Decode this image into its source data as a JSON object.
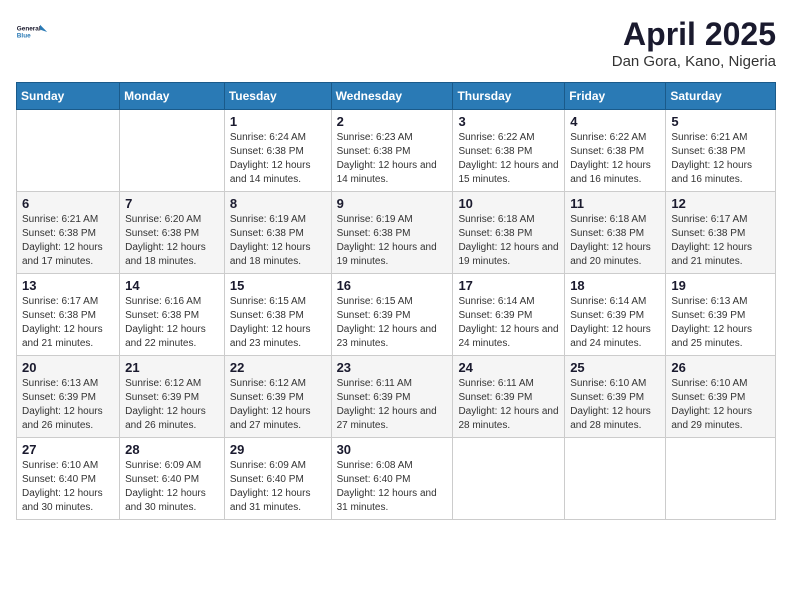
{
  "header": {
    "logo_line1": "General",
    "logo_line2": "Blue",
    "month": "April 2025",
    "location": "Dan Gora, Kano, Nigeria"
  },
  "weekdays": [
    "Sunday",
    "Monday",
    "Tuesday",
    "Wednesday",
    "Thursday",
    "Friday",
    "Saturday"
  ],
  "weeks": [
    [
      {
        "num": "",
        "info": ""
      },
      {
        "num": "",
        "info": ""
      },
      {
        "num": "1",
        "info": "Sunrise: 6:24 AM\nSunset: 6:38 PM\nDaylight: 12 hours\nand 14 minutes."
      },
      {
        "num": "2",
        "info": "Sunrise: 6:23 AM\nSunset: 6:38 PM\nDaylight: 12 hours\nand 14 minutes."
      },
      {
        "num": "3",
        "info": "Sunrise: 6:22 AM\nSunset: 6:38 PM\nDaylight: 12 hours\nand 15 minutes."
      },
      {
        "num": "4",
        "info": "Sunrise: 6:22 AM\nSunset: 6:38 PM\nDaylight: 12 hours\nand 16 minutes."
      },
      {
        "num": "5",
        "info": "Sunrise: 6:21 AM\nSunset: 6:38 PM\nDaylight: 12 hours\nand 16 minutes."
      }
    ],
    [
      {
        "num": "6",
        "info": "Sunrise: 6:21 AM\nSunset: 6:38 PM\nDaylight: 12 hours\nand 17 minutes."
      },
      {
        "num": "7",
        "info": "Sunrise: 6:20 AM\nSunset: 6:38 PM\nDaylight: 12 hours\nand 18 minutes."
      },
      {
        "num": "8",
        "info": "Sunrise: 6:19 AM\nSunset: 6:38 PM\nDaylight: 12 hours\nand 18 minutes."
      },
      {
        "num": "9",
        "info": "Sunrise: 6:19 AM\nSunset: 6:38 PM\nDaylight: 12 hours\nand 19 minutes."
      },
      {
        "num": "10",
        "info": "Sunrise: 6:18 AM\nSunset: 6:38 PM\nDaylight: 12 hours\nand 19 minutes."
      },
      {
        "num": "11",
        "info": "Sunrise: 6:18 AM\nSunset: 6:38 PM\nDaylight: 12 hours\nand 20 minutes."
      },
      {
        "num": "12",
        "info": "Sunrise: 6:17 AM\nSunset: 6:38 PM\nDaylight: 12 hours\nand 21 minutes."
      }
    ],
    [
      {
        "num": "13",
        "info": "Sunrise: 6:17 AM\nSunset: 6:38 PM\nDaylight: 12 hours\nand 21 minutes."
      },
      {
        "num": "14",
        "info": "Sunrise: 6:16 AM\nSunset: 6:38 PM\nDaylight: 12 hours\nand 22 minutes."
      },
      {
        "num": "15",
        "info": "Sunrise: 6:15 AM\nSunset: 6:38 PM\nDaylight: 12 hours\nand 23 minutes."
      },
      {
        "num": "16",
        "info": "Sunrise: 6:15 AM\nSunset: 6:39 PM\nDaylight: 12 hours\nand 23 minutes."
      },
      {
        "num": "17",
        "info": "Sunrise: 6:14 AM\nSunset: 6:39 PM\nDaylight: 12 hours\nand 24 minutes."
      },
      {
        "num": "18",
        "info": "Sunrise: 6:14 AM\nSunset: 6:39 PM\nDaylight: 12 hours\nand 24 minutes."
      },
      {
        "num": "19",
        "info": "Sunrise: 6:13 AM\nSunset: 6:39 PM\nDaylight: 12 hours\nand 25 minutes."
      }
    ],
    [
      {
        "num": "20",
        "info": "Sunrise: 6:13 AM\nSunset: 6:39 PM\nDaylight: 12 hours\nand 26 minutes."
      },
      {
        "num": "21",
        "info": "Sunrise: 6:12 AM\nSunset: 6:39 PM\nDaylight: 12 hours\nand 26 minutes."
      },
      {
        "num": "22",
        "info": "Sunrise: 6:12 AM\nSunset: 6:39 PM\nDaylight: 12 hours\nand 27 minutes."
      },
      {
        "num": "23",
        "info": "Sunrise: 6:11 AM\nSunset: 6:39 PM\nDaylight: 12 hours\nand 27 minutes."
      },
      {
        "num": "24",
        "info": "Sunrise: 6:11 AM\nSunset: 6:39 PM\nDaylight: 12 hours\nand 28 minutes."
      },
      {
        "num": "25",
        "info": "Sunrise: 6:10 AM\nSunset: 6:39 PM\nDaylight: 12 hours\nand 28 minutes."
      },
      {
        "num": "26",
        "info": "Sunrise: 6:10 AM\nSunset: 6:39 PM\nDaylight: 12 hours\nand 29 minutes."
      }
    ],
    [
      {
        "num": "27",
        "info": "Sunrise: 6:10 AM\nSunset: 6:40 PM\nDaylight: 12 hours\nand 30 minutes."
      },
      {
        "num": "28",
        "info": "Sunrise: 6:09 AM\nSunset: 6:40 PM\nDaylight: 12 hours\nand 30 minutes."
      },
      {
        "num": "29",
        "info": "Sunrise: 6:09 AM\nSunset: 6:40 PM\nDaylight: 12 hours\nand 31 minutes."
      },
      {
        "num": "30",
        "info": "Sunrise: 6:08 AM\nSunset: 6:40 PM\nDaylight: 12 hours\nand 31 minutes."
      },
      {
        "num": "",
        "info": ""
      },
      {
        "num": "",
        "info": ""
      },
      {
        "num": "",
        "info": ""
      }
    ]
  ]
}
